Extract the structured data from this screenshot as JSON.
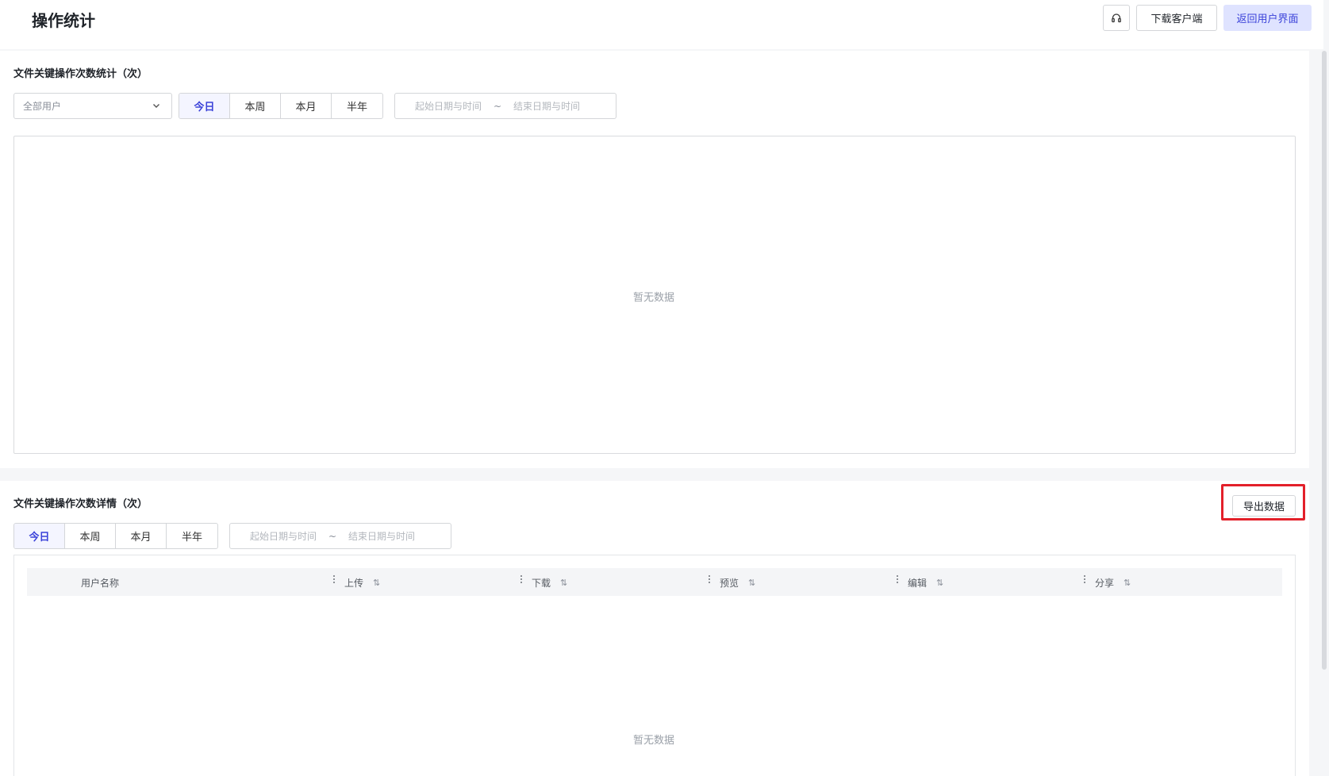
{
  "header": {
    "title": "操作统计",
    "download_client": "下载客户端",
    "return_user": "返回用户界面"
  },
  "stats": {
    "title": "文件关键操作次数统计（次）",
    "user_select": "全部用户",
    "periods": [
      "今日",
      "本周",
      "本月",
      "半年"
    ],
    "active_period": "今日",
    "date_start_placeholder": "起始日期与时间",
    "date_sep": "~",
    "date_end_placeholder": "结束日期与时间",
    "empty": "暂无数据"
  },
  "details": {
    "title": "文件关键操作次数详情（次）",
    "periods": [
      "今日",
      "本周",
      "本月",
      "半年"
    ],
    "active_period": "今日",
    "date_start_placeholder": "起始日期与时间",
    "date_sep": "~",
    "date_end_placeholder": "结束日期与时间",
    "export": "导出数据",
    "columns": [
      "用户名称",
      "上传",
      "下载",
      "预览",
      "编辑",
      "分享"
    ],
    "empty": "暂无数据"
  },
  "colors": {
    "accent": "#3b42d9",
    "highlight": "#e3202a"
  }
}
